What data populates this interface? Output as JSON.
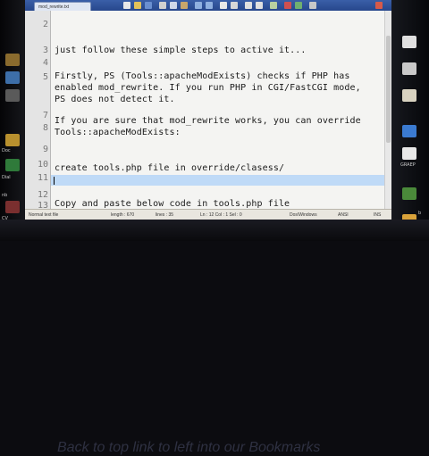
{
  "window": {
    "tab_title": "mod_rewrite.txt"
  },
  "editor": {
    "lines": [
      {
        "num": "2",
        "text": ""
      },
      {
        "num": "3",
        "text": "just follow these simple steps to active it..."
      },
      {
        "num": "4",
        "text": ""
      },
      {
        "num": "5",
        "text": "Firstly, PS (Tools::apacheModExists) checks if PHP has"
      },
      {
        "num": "",
        "text": "enabled mod_rewrite. If you run PHP in CGI/FastCGI mode,"
      },
      {
        "num": "",
        "text": "PS does not detect it."
      },
      {
        "num": "7",
        "text": ""
      },
      {
        "num": "8",
        "text": "If you are sure that mod_rewrite works, you can override"
      },
      {
        "num": "",
        "text": "Tools::apacheModExists:"
      },
      {
        "num": "9",
        "text": ""
      },
      {
        "num": "10",
        "text": ""
      },
      {
        "num": "11",
        "text": "create tools.php file in override/clasess/"
      },
      {
        "num": "12",
        "text": ""
      },
      {
        "num": "13",
        "text": ""
      },
      {
        "num": "14",
        "text": "Copy and paste below code in tools.php file"
      }
    ]
  },
  "statusbar": {
    "file_type": "Normal text file",
    "length": "length : 670",
    "lines": "lines : 35",
    "position": "Ln : 12   Col : 1   Sel : 0",
    "eol": "Dos\\Windows",
    "encoding": "ANSI",
    "mode": "INS"
  },
  "desktop": {
    "left_labels": [
      "Doc",
      "Dial",
      "nb",
      "CV",
      "GRAEP",
      "b"
    ],
    "caption": "Back to top link to left into our Bookmarks"
  }
}
